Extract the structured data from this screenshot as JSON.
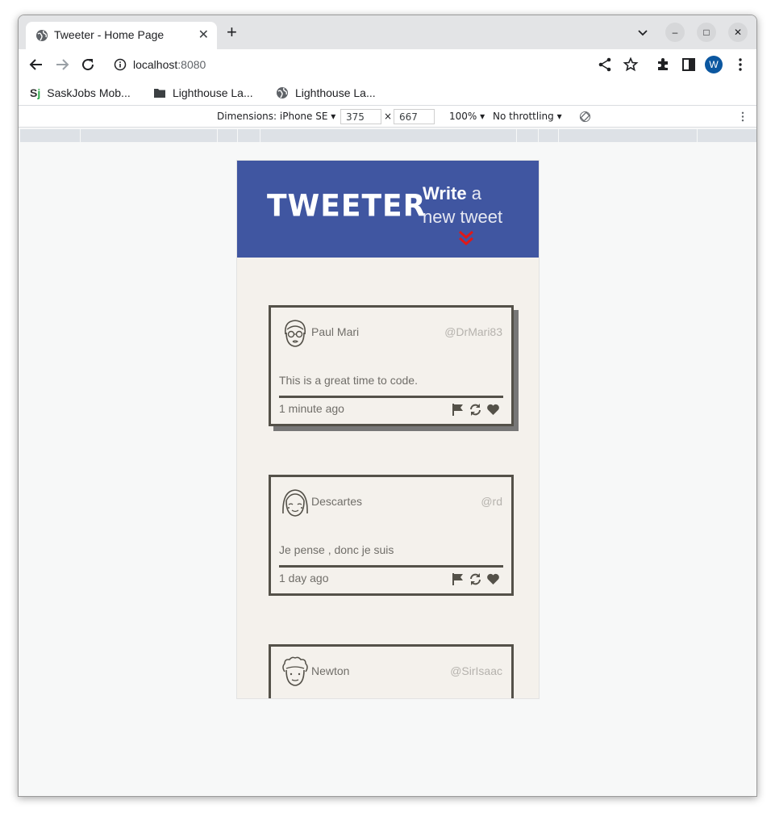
{
  "browser": {
    "tab_title": "Tweeter - Home Page",
    "tab_close": "✕",
    "new_tab": "+",
    "url_host": "localhost",
    "url_port": ":8080",
    "profile_initial": "W",
    "window_controls": [
      "–",
      "□",
      "✕"
    ]
  },
  "bookmarks": [
    {
      "label": "SaskJobs Mob...",
      "icon": "saskjobs-logo"
    },
    {
      "label": "Lighthouse La...",
      "icon": "folder-icon"
    },
    {
      "label": "Lighthouse La...",
      "icon": "globe-icon"
    }
  ],
  "bookmarks_sj_logo": "S",
  "bookmarks_sj_logo_j": "j",
  "devtools": {
    "dimensions_label": "Dimensions: iPhone SE",
    "width": "375",
    "height": "667",
    "times": "×",
    "zoom": "100%",
    "throttling": "No throttling"
  },
  "app": {
    "logo": "TWEETER",
    "write_bold": "Write",
    "write_rest1": " a",
    "write_rest2": "new tweet",
    "accent_color": "#4056a1",
    "chevron_color": "#e01818"
  },
  "tweets": [
    {
      "name": "Paul Mari",
      "handle": "@DrMari83",
      "text": "This is a great time to code.",
      "time": "1 minute ago",
      "avatar": "glasses-face-icon"
    },
    {
      "name": "Descartes",
      "handle": "@rd",
      "text": "Je pense , donc je suis",
      "time": "1 day ago",
      "avatar": "bangs-face-icon"
    },
    {
      "name": "Newton",
      "handle": "@SirIsaac",
      "text": "",
      "time": "",
      "avatar": "curly-hair-face-icon"
    }
  ]
}
